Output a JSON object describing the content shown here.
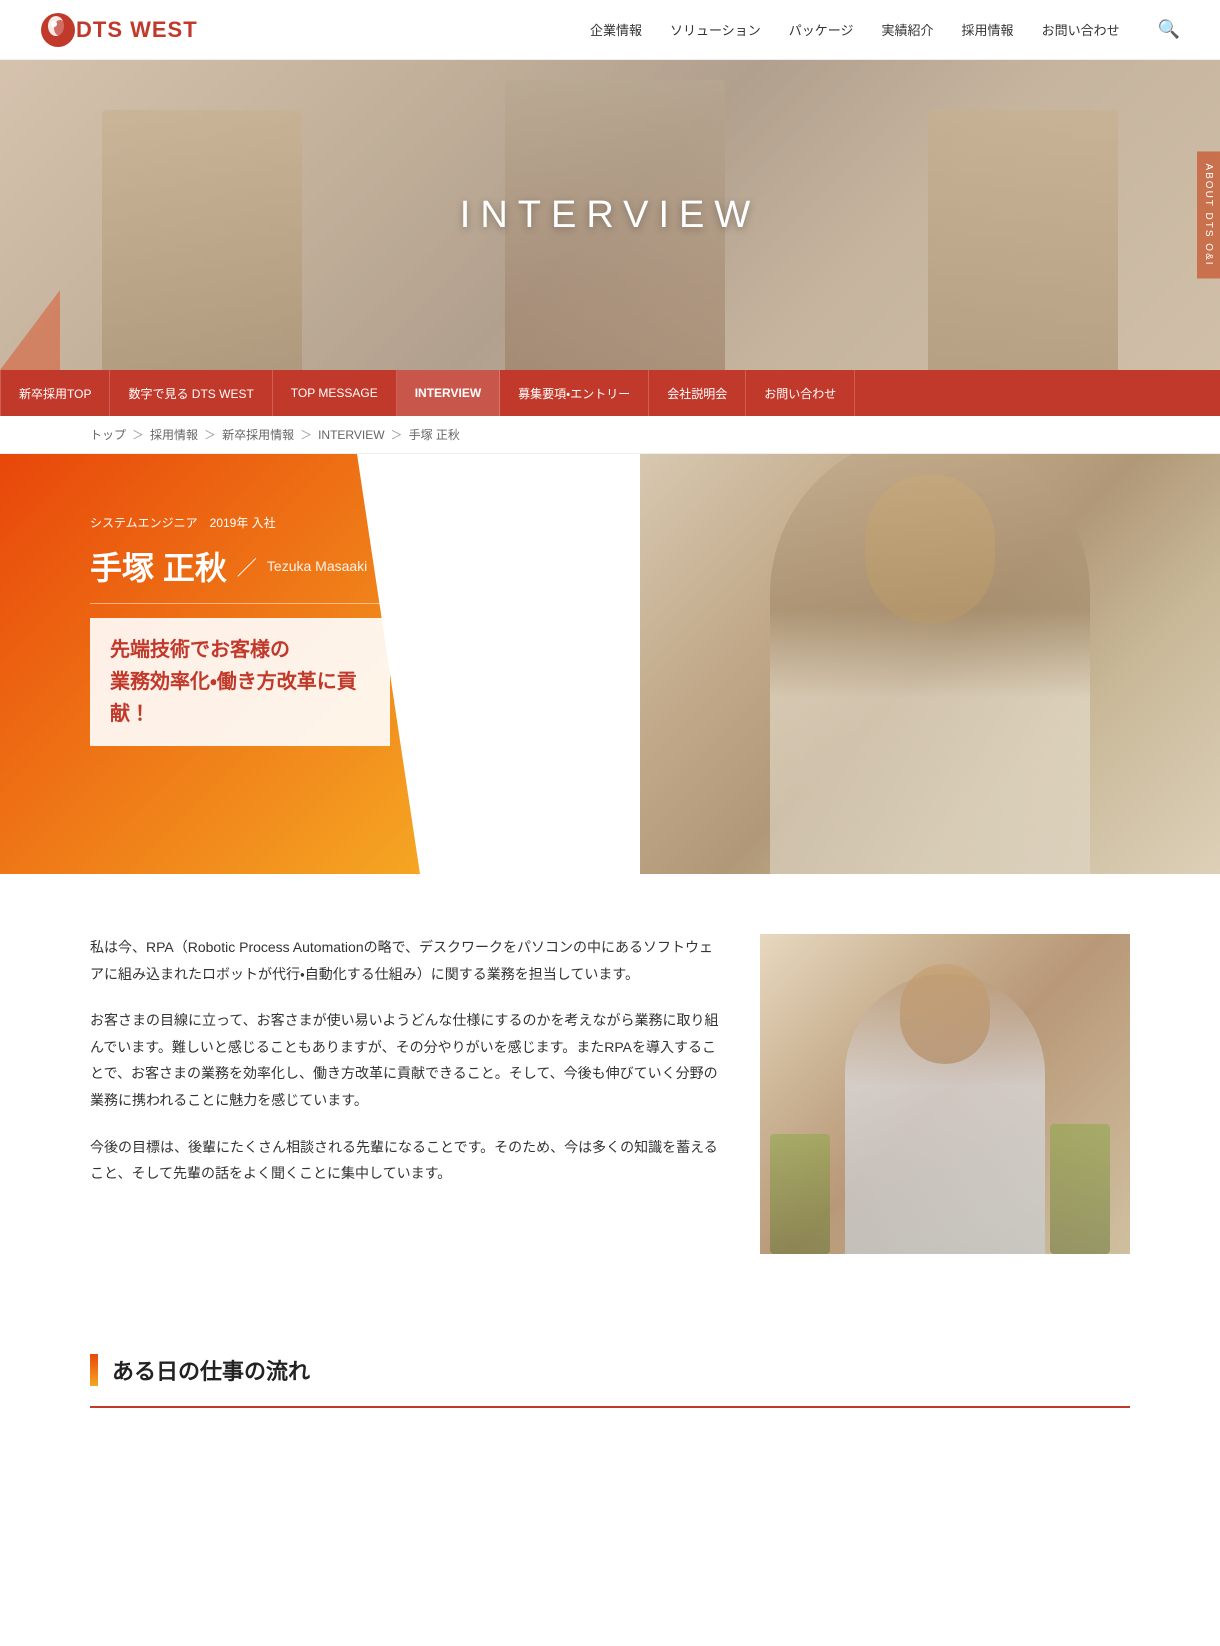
{
  "header": {
    "logo_text": "DTS WEST",
    "nav": [
      {
        "label": "企業情報",
        "href": "#"
      },
      {
        "label": "ソリューション",
        "href": "#"
      },
      {
        "label": "パッケージ",
        "href": "#"
      },
      {
        "label": "実績紹介",
        "href": "#"
      },
      {
        "label": "採用情報",
        "href": "#"
      },
      {
        "label": "お問い合わせ",
        "href": "#"
      }
    ]
  },
  "hero": {
    "title": "INTERVIEW",
    "side_tab": "ABOUT DTS O&I"
  },
  "sub_nav": [
    {
      "label": "新卒採用TOP",
      "active": false
    },
    {
      "label": "数字で見る DTS WEST",
      "active": false
    },
    {
      "label": "TOP MESSAGE",
      "active": false
    },
    {
      "label": "INTERVIEW",
      "active": true
    },
    {
      "label": "募集要項・エントリー",
      "active": false
    },
    {
      "label": "会社説明会",
      "active": false
    },
    {
      "label": "お問い合わせ",
      "active": false
    }
  ],
  "breadcrumb": [
    {
      "label": "トップ",
      "href": "#"
    },
    {
      "label": "採用情報",
      "href": "#"
    },
    {
      "label": "新卒採用情報",
      "href": "#"
    },
    {
      "label": "INTERVIEW",
      "href": "#"
    },
    {
      "label": "手塚 正秋",
      "href": "#"
    }
  ],
  "profile": {
    "tag": "システムエンジニア　2019年 入社",
    "name_ja": "手塚 正秋",
    "name_separator": "／",
    "name_en": "Tezuka Masaaki",
    "catchphrase_line1": "先端技術でお客様の",
    "catchphrase_line2": "業務効率化・働き方改革に貢献！"
  },
  "body": {
    "paragraphs": [
      "私は今、RPA（Robotic Process Automationの略で、デスクワークをパソコンの中にあるソフトウェアに組み込まれたロボットが代行・自動化する仕組み）に関する業務を担当しています。",
      "お客さまの目線に立って、お客さまが使い易いようどんな仕様にするのかを考えながら業務に取り組んでいます。難しいと感じることもありますが、その分やりがいを感じます。またRPAを導入することで、お客さまの業務を効率化し、働き方改革に貢献できること。そして、今後も伸びていく分野の業務に携われることに魅力を感じています。",
      "今後の目標は、後輩にたくさん相談される先輩になることです。そのため、今は多くの知識を蓄えること、そして先輩の話をよく聞くことに集中しています。"
    ]
  },
  "workflow_section": {
    "title": "ある日の仕事の流れ"
  }
}
